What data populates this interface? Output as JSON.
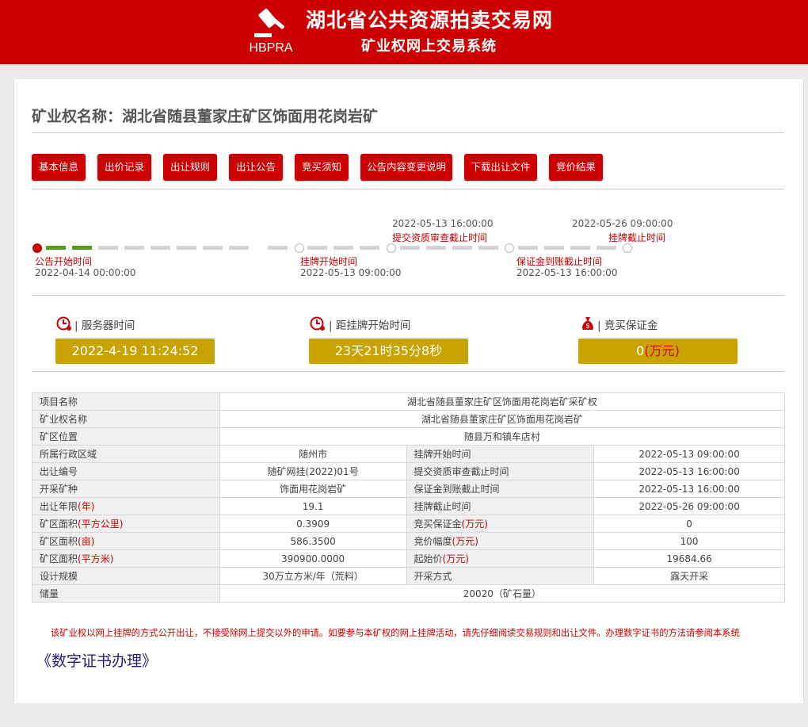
{
  "header": {
    "site_title": "湖北省公共资源拍卖交易网",
    "site_subtitle": "矿业权网上交易系统",
    "logo_text": "HBPRA",
    "logo_icon": "gavel-icon",
    "bg_color": "#cc0000"
  },
  "page": {
    "title": "矿业权名称：湖北省随县董家庄矿区饰面用花岗岩矿"
  },
  "tabs": [
    {
      "label": "基本信息"
    },
    {
      "label": "出价记录"
    },
    {
      "label": "出让规则"
    },
    {
      "label": "出让公告"
    },
    {
      "label": "竞买须知"
    },
    {
      "label": "公告内容变更说明"
    },
    {
      "label": "下载出让文件"
    },
    {
      "label": "竞价结果"
    }
  ],
  "timeline": {
    "progress_completed_segments": 2,
    "milestones": [
      {
        "label": "公告开始时间",
        "date": "2022-04-14 00:00:00"
      },
      {
        "label": "挂牌开始时间",
        "date": "2022-05-13 09:00:00"
      },
      {
        "label": "提交资质审查截止时间",
        "date": "2022-05-13 16:00:00"
      },
      {
        "label": "保证金到账截止时间",
        "date": "2022-05-13 16:00:00"
      },
      {
        "label": "挂牌截止时间",
        "date": "2022-05-26 09:00:00"
      }
    ]
  },
  "stats": {
    "server_time_label": "| 服务器时间",
    "server_time_value": "2022-4-19 11:24:52",
    "countdown_label": "| 距挂牌开始时间",
    "countdown_value": "23天21时35分8秒",
    "deposit_label": "| 竞买保证金",
    "deposit_value": "0",
    "deposit_unit": "(万元)",
    "clock_icon": "clock-icon",
    "money_icon": "money-bag-icon",
    "box_color": "#c9a300"
  },
  "info": {
    "project_name_k": "项目名称",
    "project_name_v": "湖北省随县董家庄矿区饰面用花岗岩矿采矿权",
    "mineral_name_k": "矿业权名称",
    "mineral_name_v": "湖北省随县董家庄矿区饰面用花岗岩矿",
    "location_k": "矿区位置",
    "location_v": "随县万和镇车店村",
    "region_k": "所属行政区域",
    "region_v": "随州市",
    "listing_start_k": "挂牌开始时间",
    "listing_start_v": "2022-05-13 09:00:00",
    "transfer_no_k": "出让编号",
    "transfer_no_v": "随矿网挂(2022)01号",
    "qual_deadline_k": "提交资质审查截止时间",
    "qual_deadline_v": "2022-05-13 16:00:00",
    "mineral_type_k": "开采矿种",
    "mineral_type_v": "饰面用花岗岩矿",
    "deposit_deadline_k": "保证金到账截止时间",
    "deposit_deadline_v": "2022-05-13 16:00:00",
    "term_k": "出让年限",
    "term_unit": "(年)",
    "term_v": "19.1",
    "listing_end_k": "挂牌截止时间",
    "listing_end_v": "2022-05-26 09:00:00",
    "area_km2_k": "矿区面积",
    "area_km2_unit": "(平方公里)",
    "area_km2_v": "0.3909",
    "bid_deposit_k": "竞买保证金",
    "bid_deposit_unit": "(万元)",
    "bid_deposit_v": "0",
    "area_mu_k": "矿区面积",
    "area_mu_unit": "(亩)",
    "area_mu_v": "586.3500",
    "bid_step_k": "竞价幅度",
    "bid_step_unit": "(万元)",
    "bid_step_v": "100",
    "area_m2_k": "矿区面积",
    "area_m2_unit": "(平方米)",
    "area_m2_v": "390900.0000",
    "start_price_k": "起始价",
    "start_price_unit": "(万元)",
    "start_price_v": "19684.66",
    "design_scale_k": "设计规模",
    "design_scale_v": "30万立方米/年（荒料）",
    "mining_method_k": "开采方式",
    "mining_method_v": "露天开采",
    "reserves_k": "储量",
    "reserves_v": "20020（矿石量）"
  },
  "notice": {
    "text": "该矿业权以网上挂牌的方式公开出让，不接受除网上提交以外的申请。如要参与本矿权的网上挂牌活动，请先仔细阅读交易规则和出让文件。办理数字证书的方法请参阅本系统",
    "cert_link": "《数字证书办理》"
  }
}
